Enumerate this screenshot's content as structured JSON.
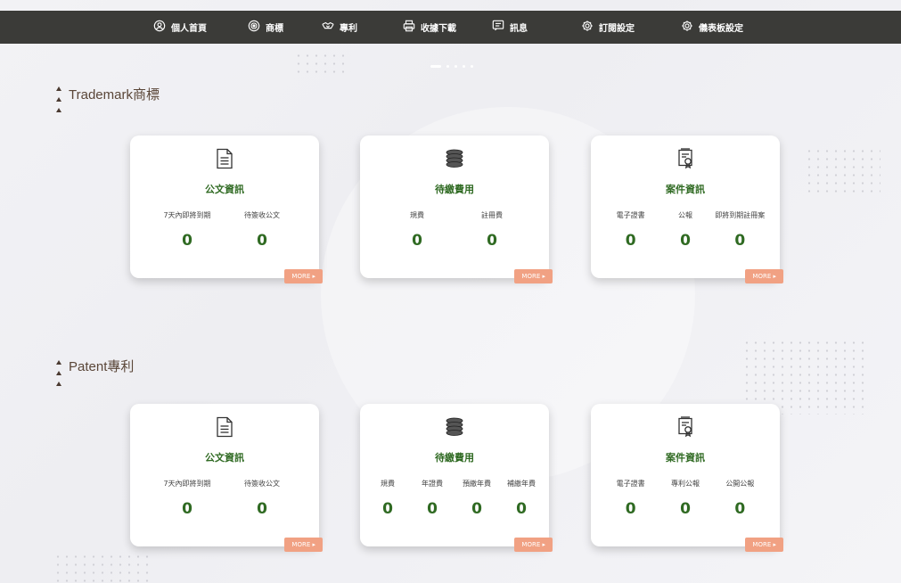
{
  "nav": [
    {
      "label": "個人首頁",
      "icon": "user-circle-icon"
    },
    {
      "label": "商標",
      "icon": "trademark-icon"
    },
    {
      "label": "專利",
      "icon": "handshake-icon"
    },
    {
      "label": "收據下載",
      "icon": "printer-icon"
    },
    {
      "label": "訊息",
      "icon": "message-icon"
    },
    {
      "label": "訂閱設定",
      "icon": "gear-icon"
    },
    {
      "label": "儀表板設定",
      "icon": "gear-icon"
    }
  ],
  "sections": {
    "trademark": {
      "title": "Trademark商標",
      "cards": [
        {
          "title": "公文資訊",
          "icon": "document-icon",
          "stats": [
            {
              "label": "7天內即將到期",
              "value": "0"
            },
            {
              "label": "待簽收公文",
              "value": "0"
            }
          ],
          "more": "MORE ▸"
        },
        {
          "title": "待繳費用",
          "icon": "coins-icon",
          "stats": [
            {
              "label": "規費",
              "value": "0"
            },
            {
              "label": "註冊費",
              "value": "0"
            }
          ],
          "more": "MORE ▸"
        },
        {
          "title": "案件資訊",
          "icon": "certificate-icon",
          "stats": [
            {
              "label": "電子證書",
              "value": "0"
            },
            {
              "label": "公報",
              "value": "0"
            },
            {
              "label": "即將到期註冊案",
              "value": "0"
            }
          ],
          "more": "MORE ▸"
        }
      ]
    },
    "patent": {
      "title": "Patent專利",
      "cards": [
        {
          "title": "公文資訊",
          "icon": "document-icon",
          "stats": [
            {
              "label": "7天內即將到期",
              "value": "0"
            },
            {
              "label": "待簽收公文",
              "value": "0"
            }
          ],
          "more": "MORE ▸"
        },
        {
          "title": "待繳費用",
          "icon": "coins-icon",
          "stats": [
            {
              "label": "規費",
              "value": "0"
            },
            {
              "label": "年證費",
              "value": "0"
            },
            {
              "label": "預繳年費",
              "value": "0"
            },
            {
              "label": "補繳年費",
              "value": "0"
            }
          ],
          "more": "MORE ▸"
        },
        {
          "title": "案件資訊",
          "icon": "certificate-icon",
          "stats": [
            {
              "label": "電子證書",
              "value": "0"
            },
            {
              "label": "專利公報",
              "value": "0"
            },
            {
              "label": "公開公報",
              "value": "0"
            }
          ],
          "more": "MORE ▸"
        }
      ]
    }
  },
  "colors": {
    "nav_bg": "#3b3b38",
    "accent_green": "#2f6a22",
    "more_button": "#f1a183",
    "heading": "#5a4638"
  }
}
